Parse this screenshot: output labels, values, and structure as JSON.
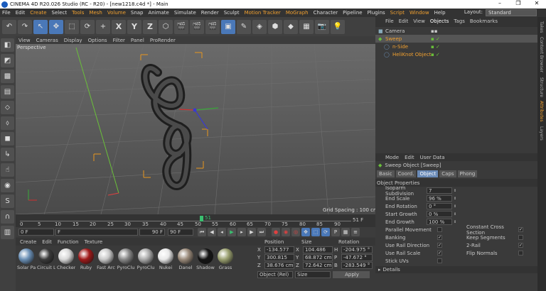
{
  "window": {
    "title": "CINEMA 4D R20.026 Studio (RC - R20) - [new1218.c4d *] - Main"
  },
  "menu": [
    "File",
    "Edit",
    "Create",
    "Select",
    "Tools",
    "Mesh",
    "Volume",
    "Snap",
    "Animate",
    "Simulate",
    "Render",
    "Sculpt",
    "Motion Tracker",
    "MoGraph",
    "Character",
    "Pipeline",
    "Plugins",
    "Script",
    "Window",
    "Help"
  ],
  "layout": {
    "label": "Layout:",
    "value": "Standard"
  },
  "toolbar": {
    "x": "X",
    "y": "Y",
    "z": "Z"
  },
  "viewport": {
    "menu": [
      "View",
      "Cameras",
      "Display",
      "Options",
      "Filter",
      "Panel",
      "ProRender"
    ],
    "label": "Perspective",
    "grid": "Grid Spacing : 100 cm"
  },
  "timeline": {
    "ticks": [
      "0",
      "5",
      "10",
      "15",
      "20",
      "25",
      "30",
      "35",
      "40",
      "45",
      "50",
      "55",
      "60",
      "65",
      "70",
      "75",
      "80",
      "85",
      "90"
    ],
    "current": "51 F",
    "cur_num": "51"
  },
  "playback": {
    "start": "0 F",
    "current": "F",
    "end_field": "90 F",
    "end": "90 F"
  },
  "materials": {
    "menu": [
      "Create",
      "Edit",
      "Function",
      "Texture"
    ],
    "items": [
      {
        "name": "Solar Pa",
        "color": "#6a8fb5"
      },
      {
        "name": "Circuit L",
        "color": "#3a3a3a"
      },
      {
        "name": "Checker",
        "color": "#d8d8d8"
      },
      {
        "name": "Ruby",
        "color": "#a01a1a"
      },
      {
        "name": "Fast Arc",
        "color": "#c9c9c9"
      },
      {
        "name": "PyroClu",
        "color": "#888888"
      },
      {
        "name": "PyroClu",
        "color": "#aaaaaa"
      },
      {
        "name": "Nukei",
        "color": "#e8e8e8"
      },
      {
        "name": "Danel",
        "color": "#9a8a7a"
      },
      {
        "name": "Shadow",
        "color": "#151515"
      },
      {
        "name": "Grass",
        "color": "#9aa070"
      }
    ]
  },
  "coords": {
    "headers": [
      "Position",
      "Size",
      "Rotation"
    ],
    "rows": [
      {
        "axis": "X",
        "pos": "-134.577 cm",
        "size": "104.486 cm",
        "rlbl": "H",
        "rot": "-204.975 °"
      },
      {
        "axis": "Y",
        "pos": "300.815 cm",
        "size": "68.872 cm",
        "rlbl": "P",
        "rot": "-47.672 °"
      },
      {
        "axis": "Z",
        "pos": "38.676 cm",
        "size": "72.642 cm",
        "rlbl": "B",
        "rot": "-283.549 °"
      }
    ],
    "mode": "Object (Rel)",
    "size_mode": "Size",
    "apply": "Apply"
  },
  "objects": {
    "menu": [
      "File",
      "Edit",
      "View",
      "Objects",
      "Tags",
      "Bookmarks"
    ],
    "items": [
      {
        "name": "Camera",
        "color": "#c8c8c8"
      },
      {
        "name": "Sweep",
        "color": "#f0a030"
      },
      {
        "name": "n-Side",
        "color": "#f0a030"
      },
      {
        "name": "HeliKnot Object",
        "color": "#f0a030"
      }
    ]
  },
  "side_tabs": [
    "Takes",
    "Content Browser",
    "Structure",
    "Attributes",
    "Layers"
  ],
  "attributes": {
    "menu": [
      "Mode",
      "Edit",
      "User Data"
    ],
    "title": "Sweep Object [Sweep]",
    "tabs": [
      "Basic",
      "Coord.",
      "Object",
      "Caps",
      "Phong"
    ],
    "section": "Object Properties",
    "props": [
      {
        "label": "Isoparm Subdivision",
        "value": "7"
      },
      {
        "label": "End Scale",
        "value": "96 %"
      },
      {
        "label": "End Rotation",
        "value": "0 °"
      },
      {
        "label": "Start Growth",
        "value": "0 %"
      },
      {
        "label": "End Growth",
        "value": "100 %"
      }
    ],
    "checks_left": [
      {
        "label": "Parallel Movement",
        "checked": ""
      },
      {
        "label": "Banking",
        "checked": "✓"
      },
      {
        "label": "Use Rail Direction",
        "checked": "✓"
      },
      {
        "label": "Use Rail Scale",
        "checked": "✓"
      },
      {
        "label": "Stick UVs",
        "checked": ""
      }
    ],
    "checks_right": [
      {
        "label": "Constant Cross Section",
        "checked": "✓"
      },
      {
        "label": "Keep Segments",
        "checked": ""
      },
      {
        "label": "2-Rail",
        "checked": "✓"
      },
      {
        "label": "Flip Normals",
        "checked": ""
      }
    ],
    "details": "Details"
  }
}
